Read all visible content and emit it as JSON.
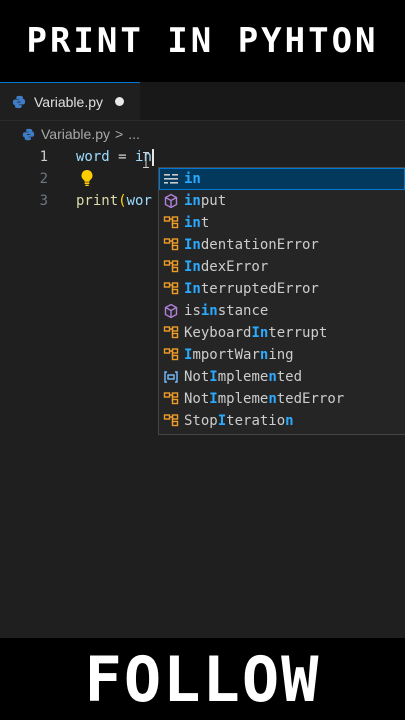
{
  "banner_top": {
    "text": "PRINT IN PYHTON"
  },
  "banner_bottom": {
    "text": "FOLLOW"
  },
  "tab": {
    "filename": "Variable.py"
  },
  "breadcrumb": {
    "file": "Variable.py",
    "separator": ">",
    "more": "..."
  },
  "editor": {
    "lines": [
      {
        "number": "1",
        "var": "word",
        "op": " = ",
        "typed": "in"
      },
      {
        "number": "2"
      },
      {
        "number": "3",
        "fn": "print",
        "paren": "(",
        "arg": "wor"
      }
    ]
  },
  "suggestions": [
    {
      "icon": "keyword-icon",
      "parts": [
        [
          "in",
          true
        ]
      ]
    },
    {
      "icon": "method-icon",
      "parts": [
        [
          "in",
          true
        ],
        [
          "put",
          false
        ]
      ]
    },
    {
      "icon": "class-icon",
      "parts": [
        [
          "in",
          true
        ],
        [
          "t",
          false
        ]
      ]
    },
    {
      "icon": "class-icon",
      "parts": [
        [
          "In",
          true
        ],
        [
          "dentationError",
          false
        ]
      ]
    },
    {
      "icon": "class-icon",
      "parts": [
        [
          "In",
          true
        ],
        [
          "dexError",
          false
        ]
      ]
    },
    {
      "icon": "class-icon",
      "parts": [
        [
          "In",
          true
        ],
        [
          "terruptedError",
          false
        ]
      ]
    },
    {
      "icon": "method-icon",
      "parts": [
        [
          "i",
          false
        ],
        [
          "s",
          false
        ],
        [
          "in",
          true
        ],
        [
          "stance",
          false
        ]
      ]
    },
    {
      "icon": "class-icon",
      "parts": [
        [
          "Keyboard",
          false
        ],
        [
          "In",
          true
        ],
        [
          "terrupt",
          false
        ]
      ]
    },
    {
      "icon": "class-icon",
      "parts": [
        [
          "I",
          true
        ],
        [
          "mportWar",
          false
        ],
        [
          "n",
          true
        ],
        [
          "ing",
          false
        ]
      ]
    },
    {
      "icon": "variable-icon",
      "parts": [
        [
          "Not",
          false
        ],
        [
          "I",
          true
        ],
        [
          "mpleme",
          false
        ],
        [
          "n",
          true
        ],
        [
          "ted",
          false
        ]
      ]
    },
    {
      "icon": "class-icon",
      "parts": [
        [
          "Not",
          false
        ],
        [
          "I",
          true
        ],
        [
          "mpleme",
          false
        ],
        [
          "n",
          true
        ],
        [
          "tedError",
          false
        ]
      ]
    },
    {
      "icon": "class-icon",
      "parts": [
        [
          "Stop",
          false
        ],
        [
          "I",
          true
        ],
        [
          "teratio",
          false
        ],
        [
          "n",
          true
        ]
      ]
    }
  ],
  "colors": {
    "accent": "#0078d4",
    "match_highlight": "#2aaaff",
    "class_icon": "#ee9d28",
    "method_icon": "#b180d7",
    "variable_icon": "#75beff"
  }
}
